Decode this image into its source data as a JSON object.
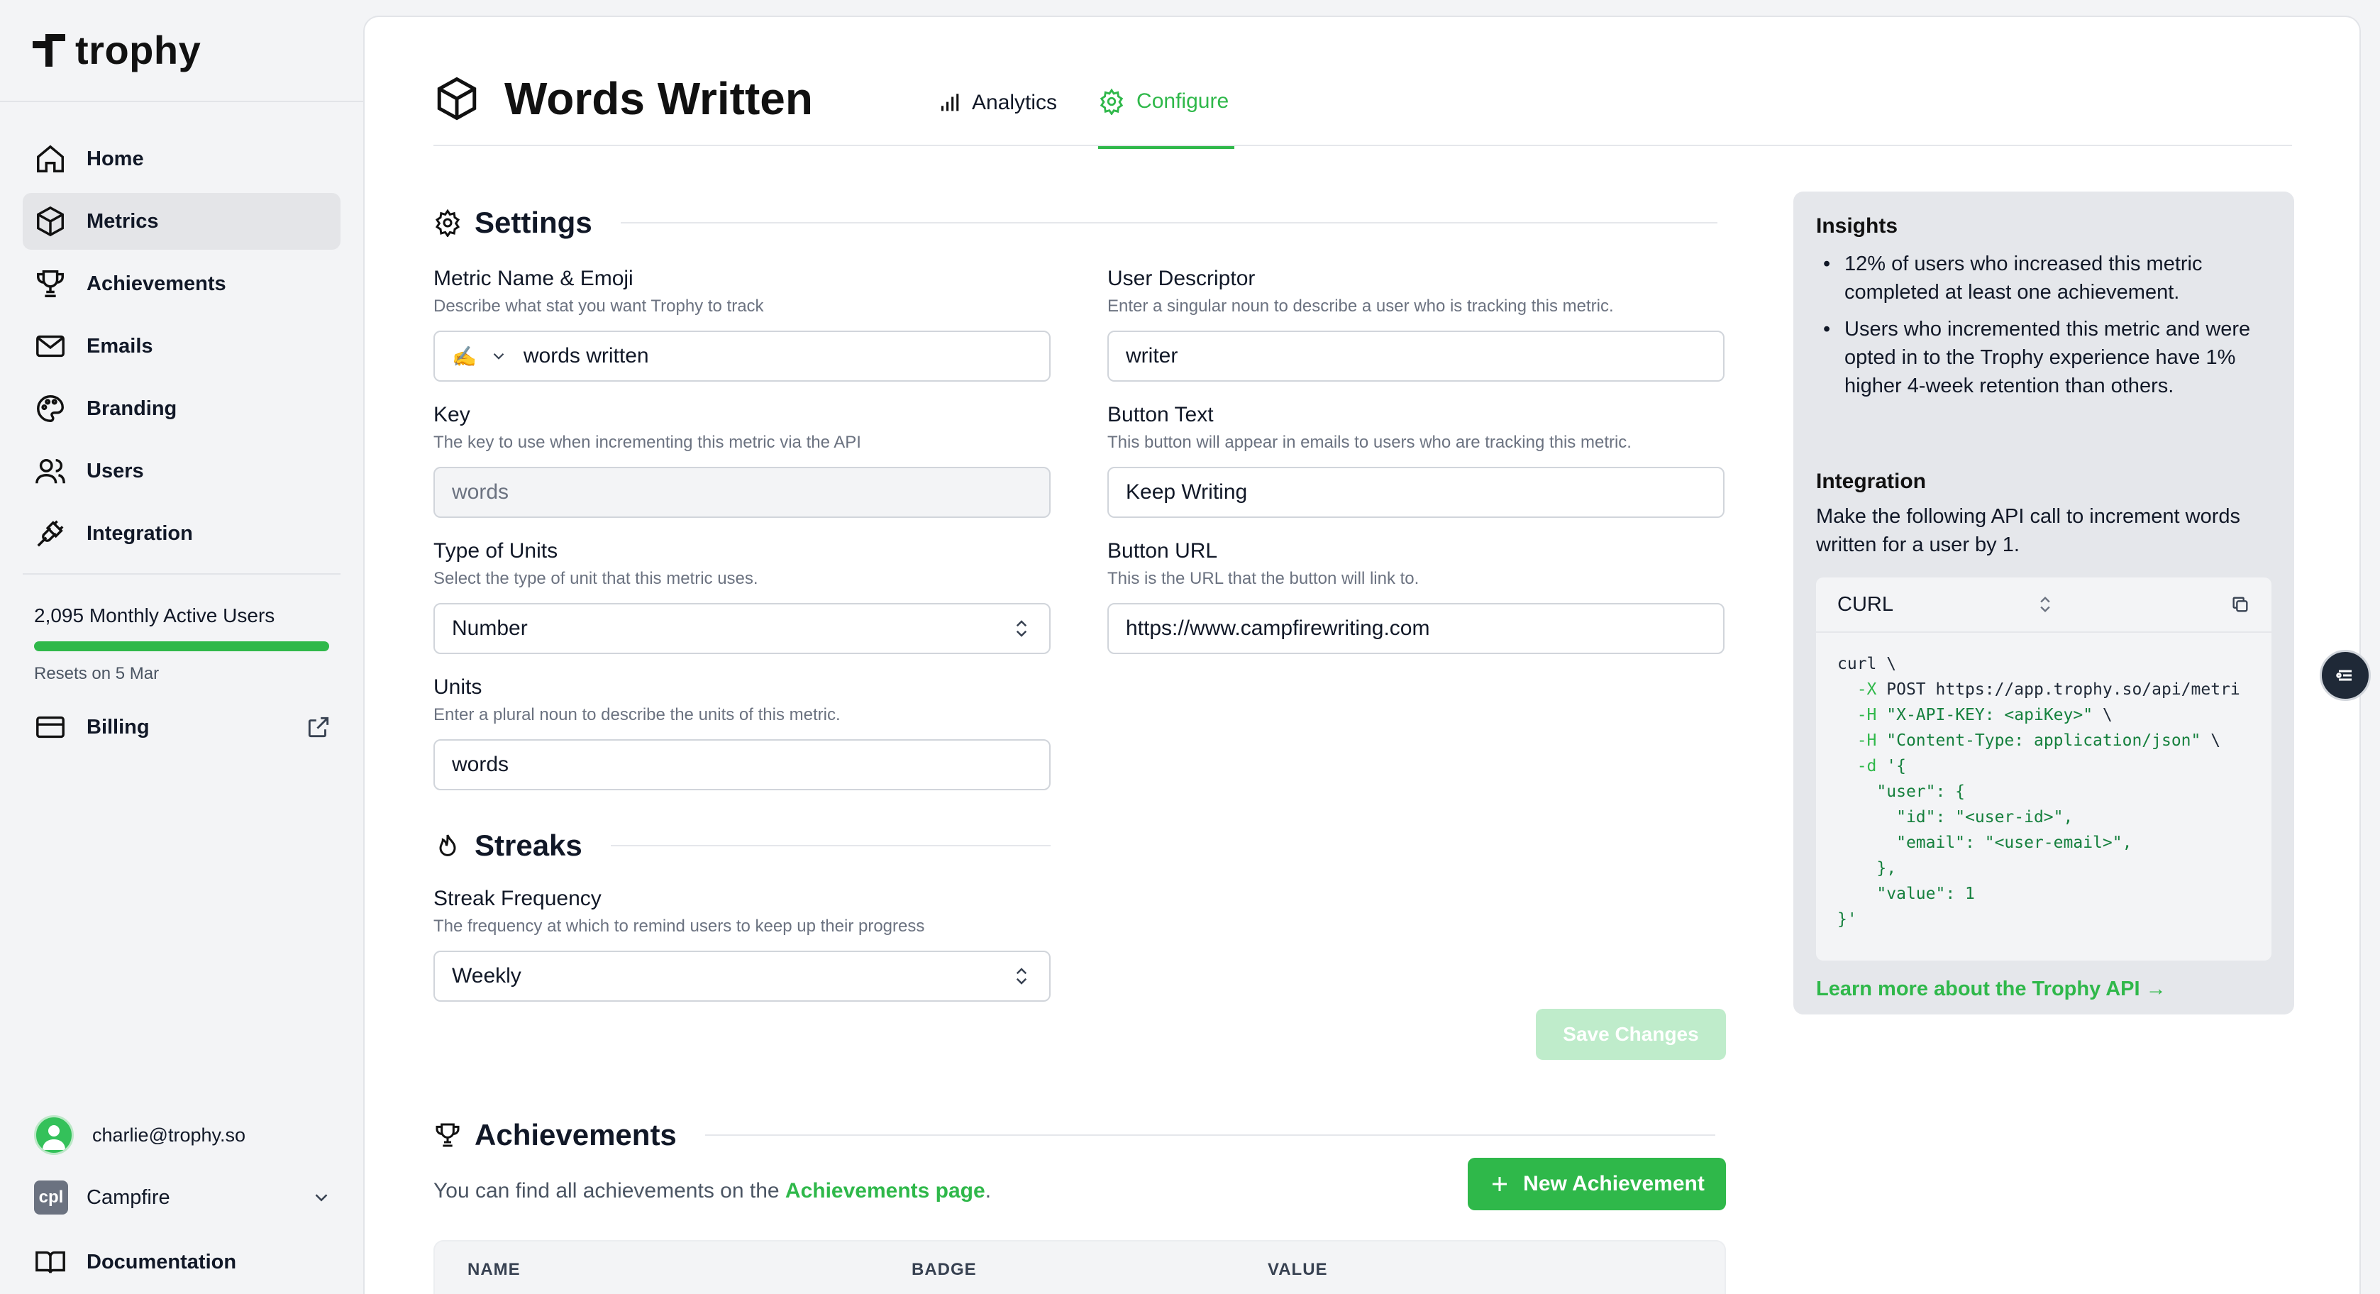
{
  "brand": {
    "name": "trophy",
    "accent": "#2fb84a"
  },
  "sidebar": {
    "nav": [
      {
        "label": "Home",
        "icon": "home-icon"
      },
      {
        "label": "Metrics",
        "icon": "cube-icon",
        "active": true
      },
      {
        "label": "Achievements",
        "icon": "trophy-icon"
      },
      {
        "label": "Emails",
        "icon": "mail-icon"
      },
      {
        "label": "Branding",
        "icon": "palette-icon"
      },
      {
        "label": "Users",
        "icon": "users-icon"
      },
      {
        "label": "Integration",
        "icon": "plug-icon"
      }
    ],
    "mau": {
      "text": "2,095 Monthly Active Users",
      "reset": "Resets on 5 Mar",
      "progress": 1.0
    },
    "billing": "Billing",
    "user_email": "charlie@trophy.so",
    "org": {
      "name": "Campfire",
      "logo_text": "cpl"
    },
    "docs": "Documentation"
  },
  "page": {
    "title": "Words Written",
    "tabs": [
      {
        "label": "Analytics",
        "icon": "bar-chart-icon"
      },
      {
        "label": "Configure",
        "icon": "gear-icon",
        "active": true
      }
    ]
  },
  "settings": {
    "heading": "Settings",
    "metric_name": {
      "label": "Metric Name & Emoji",
      "desc": "Describe what stat you want Trophy to track",
      "emoji": "✍️",
      "value": "words written"
    },
    "key": {
      "label": "Key",
      "desc": "The key to use when incrementing this metric via the API",
      "value": "words"
    },
    "unit_type": {
      "label": "Type of Units",
      "desc": "Select the type of unit that this metric uses.",
      "value": "Number"
    },
    "units": {
      "label": "Units",
      "desc": "Enter a plural noun to describe the units of this metric.",
      "value": "words"
    },
    "user_descriptor": {
      "label": "User Descriptor",
      "desc": "Enter a singular noun to describe a user who is tracking this metric.",
      "value": "writer"
    },
    "button_text": {
      "label": "Button Text",
      "desc": "This button will appear in emails to users who are tracking this metric.",
      "value": "Keep Writing"
    },
    "button_url": {
      "label": "Button URL",
      "desc": "This is the URL that the button will link to.",
      "value": "https://www.campfirewriting.com"
    },
    "save_label": "Save Changes"
  },
  "streaks": {
    "heading": "Streaks",
    "frequency": {
      "label": "Streak Frequency",
      "desc": "The frequency at which to remind users to keep up their progress",
      "value": "Weekly"
    }
  },
  "achievements": {
    "heading": "Achievements",
    "text_prefix": "You can find all achievements on the",
    "link_text": "Achievements page",
    "text_suffix": ".",
    "new_button": "New Achievement",
    "columns": [
      "NAME",
      "BADGE",
      "VALUE"
    ]
  },
  "insights": {
    "heading": "Insights",
    "items": [
      "12% of users who increased this metric completed at least one achievement.",
      "Users who incremented this metric and were opted in to the Trophy experience have 1% higher 4-week retention than others."
    ],
    "integration_heading": "Integration",
    "integration_text": "Make the following API call to increment words written for a user by 1.",
    "code_lang": "CURL",
    "code": {
      "l1": "curl \\",
      "l2a": "-X",
      "l2b": "POST https://app.trophy.so/api/metri",
      "l3a": "-H",
      "l3b": "\"X-API-KEY: <apiKey>\"",
      "l3c": " \\",
      "l4a": "-H",
      "l4b": "\"Content-Type: application/json\"",
      "l4c": " \\",
      "l5a": "-d",
      "l5b": "'{",
      "l6": "  \"user\": {",
      "l7a": "    \"id\": ",
      "l7b": "\"<user-id>\"",
      "l7c": ",",
      "l8a": "    \"email\": ",
      "l8b": "\"<user-email>\"",
      "l8c": ",",
      "l9": "  },",
      "l10a": "  \"value\": ",
      "l10b": "1",
      "l11": "}'"
    },
    "learn_more": "Learn more about the Trophy API →"
  }
}
